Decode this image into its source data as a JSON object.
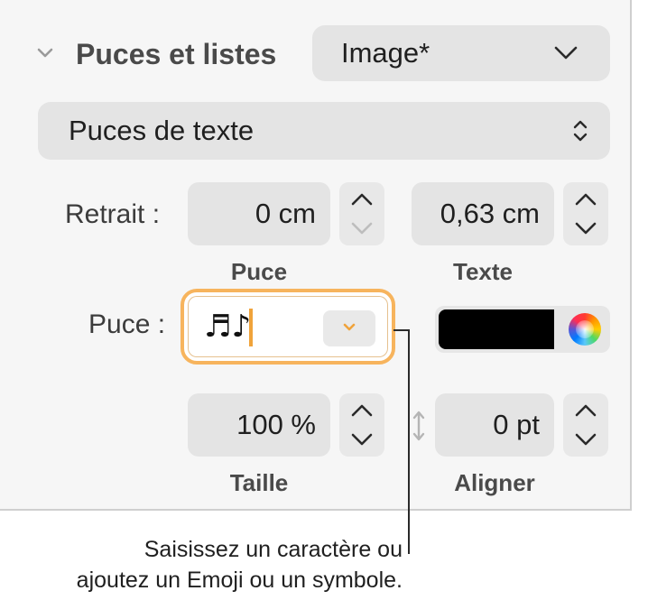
{
  "section": {
    "title": "Puces et listes",
    "style_popup": "Image*"
  },
  "bullet_type": "Puces de texte",
  "indent": {
    "label": "Retrait :",
    "bullet_value": "0 cm",
    "text_value": "0,63 cm",
    "bullet_caption": "Puce",
    "text_caption": "Texte"
  },
  "bullet": {
    "label": "Puce :",
    "value": "♬♪",
    "color": "#000000"
  },
  "size": {
    "value": "100 %",
    "caption": "Taille"
  },
  "align": {
    "value": "0 pt",
    "caption": "Aligner"
  },
  "callout": {
    "line1": "Saisissez un caractère ou",
    "line2": "ajoutez un Emoji ou un symbole."
  },
  "colors": {
    "focus_ring": "#f7b45d",
    "cursor": "#f0a33b"
  }
}
